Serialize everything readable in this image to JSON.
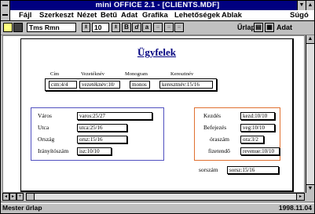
{
  "window": {
    "title": "mini OFFICE 2.1 - [CLIENTS.MDF]"
  },
  "menu": {
    "items": [
      {
        "label": "Fájl"
      },
      {
        "label": "Szerkeszt"
      },
      {
        "label": "Nézet"
      },
      {
        "label": "Betű"
      },
      {
        "label": "Adat"
      },
      {
        "label": "Grafika"
      },
      {
        "label": "Lehetőségek"
      },
      {
        "label": "Ablak"
      },
      {
        "label": "Súgó"
      }
    ]
  },
  "toolbar": {
    "font_name": "Tms Rmn",
    "font_size": "10",
    "bold": "B",
    "italic": "d",
    "underline": "a",
    "form_label": "Űrlap",
    "data_label": "Adat"
  },
  "form": {
    "title": "Ügyfelek",
    "columns": [
      "Cím",
      "Vezetéknév",
      "Monogram",
      "Keresztnév"
    ],
    "top_fields": [
      "cim:4/4",
      "vezetéknév:10/",
      "monos",
      "keresztnév:15/16"
    ],
    "left_group": [
      {
        "label": "Város",
        "value": "varos:25/27"
      },
      {
        "label": "Utca",
        "value": "utca:25/16"
      },
      {
        "label": "Ország",
        "value": "orsz:15/16"
      },
      {
        "label": "Irányítószám",
        "value": "isz:10/10"
      }
    ],
    "right_group": [
      {
        "label": "Kezdés",
        "value": "kezd:10/10"
      },
      {
        "label": "Befejezés",
        "value": "veg:10/10"
      },
      {
        "label": "óraszám",
        "value": "ora:3/2"
      },
      {
        "label": "fizetendő",
        "value": "revenue:10/10"
      }
    ],
    "serial": {
      "label": "sorszám",
      "value": "sorsz:15/16"
    }
  },
  "status": {
    "mode": "Mester űrlap",
    "date": "1998.11.04"
  }
}
